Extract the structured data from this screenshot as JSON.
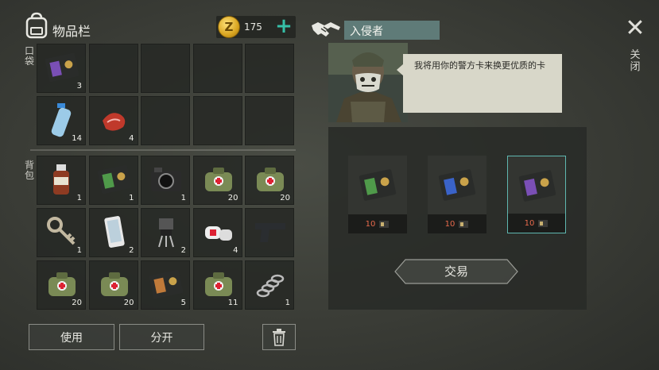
{
  "inventory": {
    "title": "物品栏",
    "coins": "175",
    "coin_symbol": "Z",
    "plus_label": "+",
    "pocket_label": "口袋",
    "backpack_label": "背包",
    "pocket_items": [
      {
        "name": "police-card-purple-icon",
        "count": "3"
      },
      {
        "name": "empty",
        "count": ""
      },
      {
        "name": "empty",
        "count": ""
      },
      {
        "name": "empty",
        "count": ""
      },
      {
        "name": "empty",
        "count": ""
      },
      {
        "name": "water-bottle-icon",
        "count": "14"
      },
      {
        "name": "raw-meat-icon",
        "count": "4"
      },
      {
        "name": "empty",
        "count": ""
      },
      {
        "name": "empty",
        "count": ""
      },
      {
        "name": "empty",
        "count": ""
      }
    ],
    "backpack_items": [
      {
        "name": "medicine-bottle-icon",
        "count": "1"
      },
      {
        "name": "police-card-green-icon",
        "count": "1"
      },
      {
        "name": "camera-icon",
        "count": "1"
      },
      {
        "name": "medkit-bag-icon",
        "count": "20"
      },
      {
        "name": "medkit-bag-icon",
        "count": "20"
      },
      {
        "name": "key-icon",
        "count": "1"
      },
      {
        "name": "smartphone-icon",
        "count": "2"
      },
      {
        "name": "transistor-icon",
        "count": "2"
      },
      {
        "name": "bandage-icon",
        "count": "4"
      },
      {
        "name": "pistol-icon",
        "count": ""
      },
      {
        "name": "medkit-bag-icon",
        "count": "20"
      },
      {
        "name": "medkit-bag-icon",
        "count": "20"
      },
      {
        "name": "police-card-orange-icon",
        "count": "5"
      },
      {
        "name": "medkit-bag-icon",
        "count": "11"
      },
      {
        "name": "spring-icon",
        "count": "1"
      }
    ],
    "use_label": "使用",
    "split_label": "分开",
    "trash_icon": "trash-icon"
  },
  "trader": {
    "name": "入侵者",
    "message": "我将用你的警方卡来换更优质的卡",
    "offers": [
      {
        "card": "police-card-green",
        "price": "10",
        "selected": false
      },
      {
        "card": "police-card-blue",
        "price": "10",
        "selected": false
      },
      {
        "card": "police-card-purple",
        "price": "10",
        "selected": true
      }
    ],
    "trade_label": "交易",
    "close_label": "关闭",
    "close_symbol": "✕"
  },
  "colors": {
    "accent": "#36c0a8",
    "name_bar": "#5f7b78",
    "price": "#e86a4c",
    "selected_border": "#5fb7b0"
  }
}
